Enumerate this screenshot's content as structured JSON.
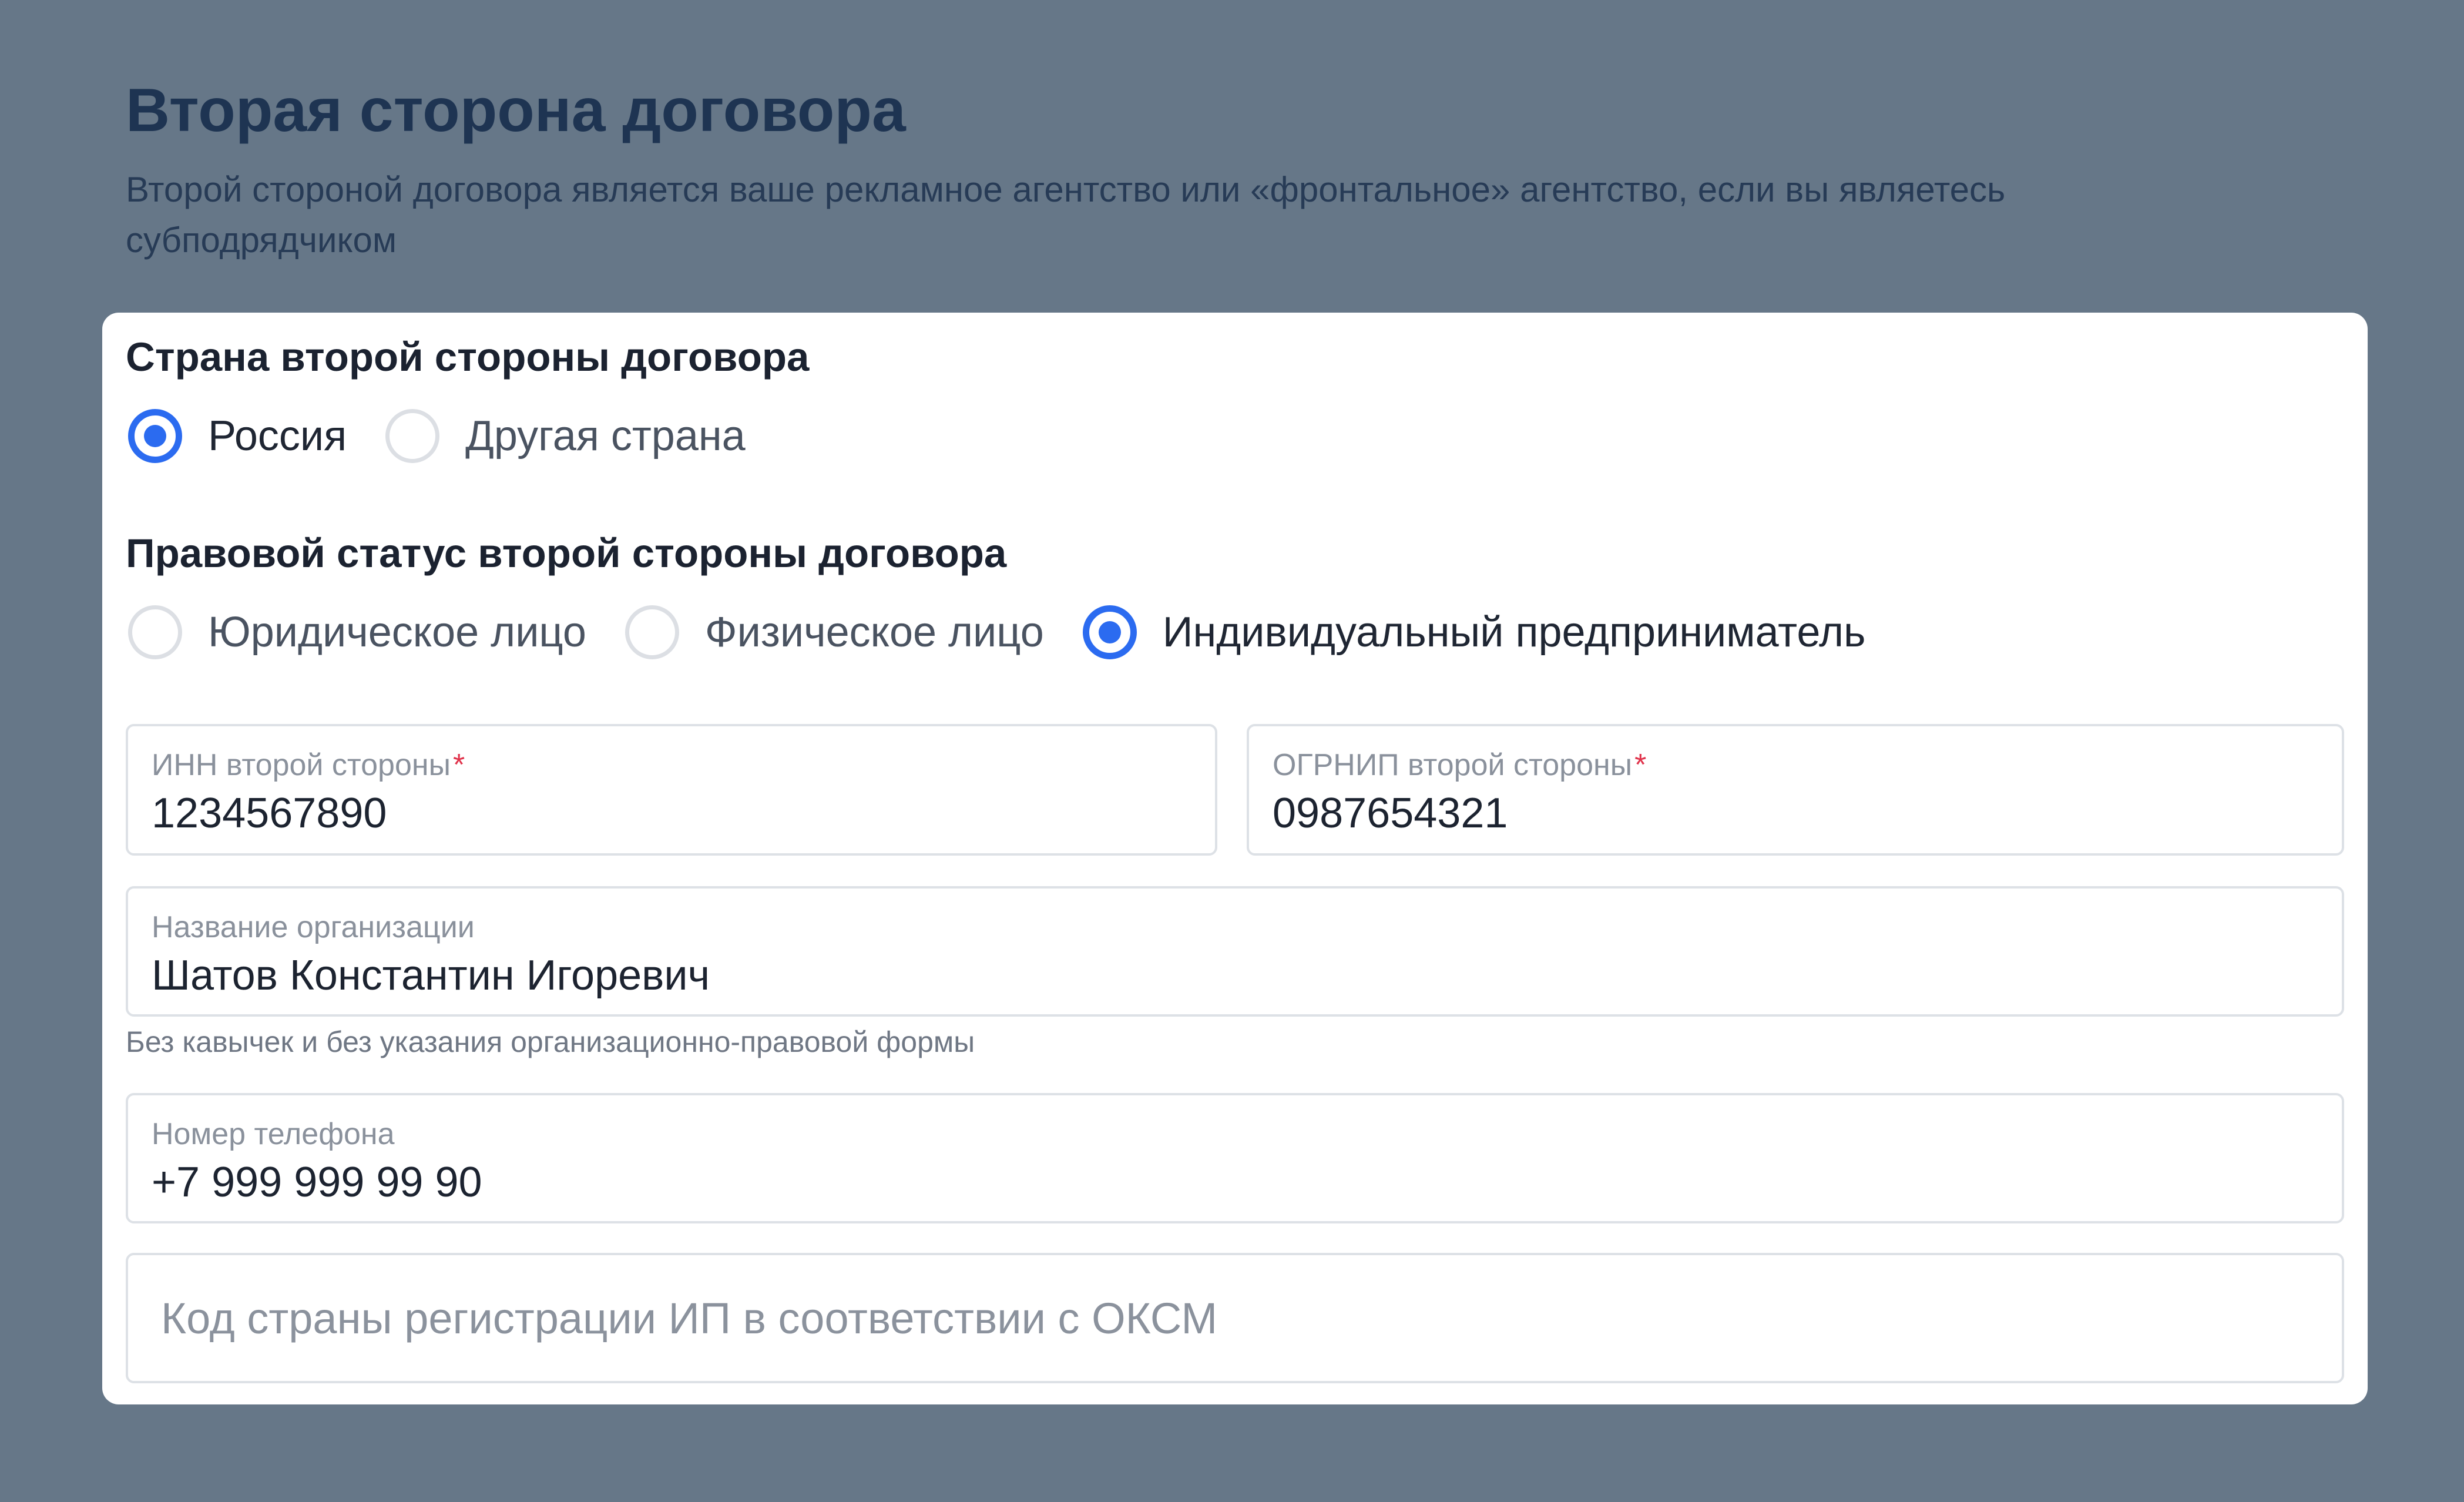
{
  "header": {
    "title": "Вторая сторона договора",
    "subtitle": "Второй стороной договора является ваше рекламное агентство или «фронтальное» агентство, если вы являетесь субподрядчиком"
  },
  "country": {
    "label": "Страна второй стороны договора",
    "options": [
      {
        "label": "Россия",
        "selected": true
      },
      {
        "label": "Другая страна",
        "selected": false
      }
    ]
  },
  "legal_status": {
    "label": "Правовой статус второй стороны договора",
    "options": [
      {
        "label": "Юридическое лицо",
        "selected": false
      },
      {
        "label": "Физическое лицо",
        "selected": false
      },
      {
        "label": "Индивидуальный предприниматель",
        "selected": true
      }
    ]
  },
  "fields": {
    "inn": {
      "label": "ИНН второй стороны",
      "required_mark": "*",
      "value": "1234567890"
    },
    "ogrnip": {
      "label": "ОГРНИП второй стороны",
      "required_mark": "*",
      "value": "0987654321"
    },
    "org_name": {
      "label": "Название организации",
      "value": "Шатов Константин Игоревич",
      "hint": "Без кавычек и без указания организационно-правовой формы"
    },
    "phone": {
      "label": "Номер телефона",
      "value": "+7 999 999 99 90"
    },
    "oksm": {
      "placeholder": "Код страны регистрации ИП в соответствии с ОКСМ",
      "value": ""
    }
  },
  "colors": {
    "background": "#667788",
    "accent": "#2b6bf0",
    "required": "#e0334b"
  }
}
